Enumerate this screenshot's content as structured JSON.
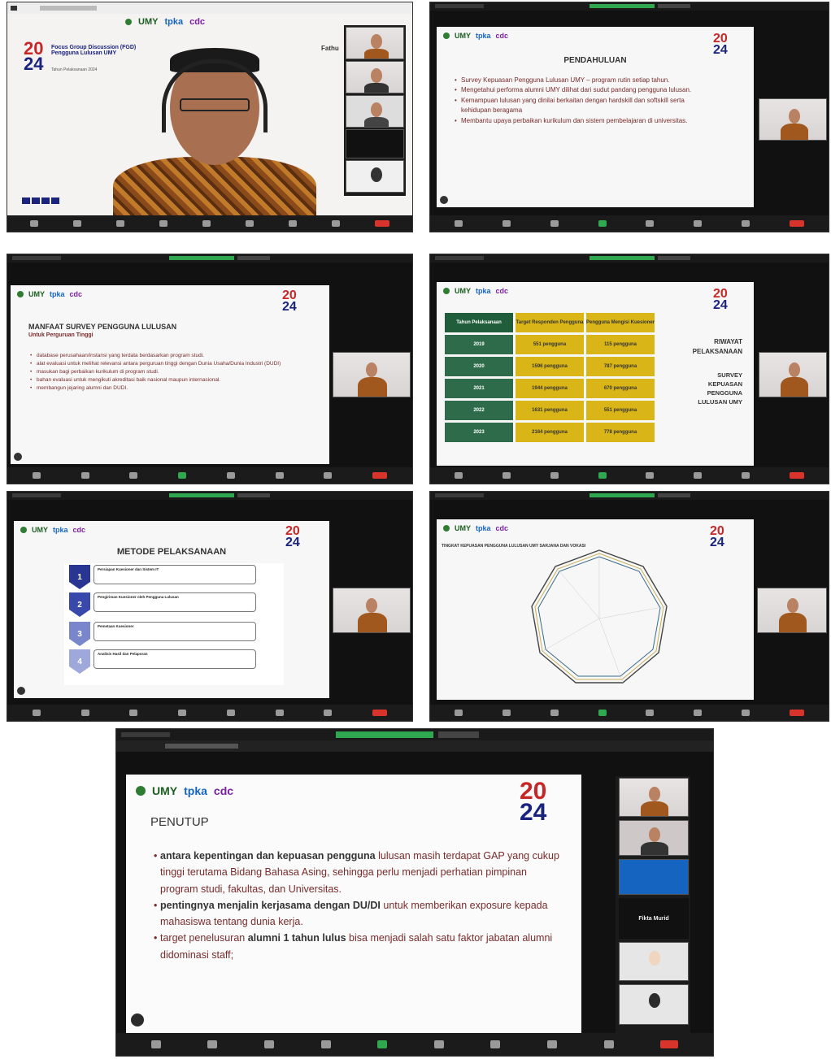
{
  "colors": {
    "accent_red": "#c62828",
    "accent_navy": "#1a237e",
    "record_green": "#2fa84f",
    "end_red": "#d9342b",
    "umy_green": "#1b5e20"
  },
  "logos": {
    "umy": "UMY",
    "tpka": "tpka",
    "cdc": "cdc"
  },
  "badge": {
    "top": "20",
    "bottom": "24"
  },
  "shot1": {
    "fgd_title": "Focus Group Discussion (FGD) Pengguna Lulusan UMY",
    "fgd_year": "Tahun Pelaksanaan 2024",
    "speaker_name": "Fathu"
  },
  "shot2": {
    "title": "PENDAHULUAN",
    "bullets": [
      {
        "text": "Survey Kepuasan Pengguna Lulusan UMY – program rutin setiap tahun."
      },
      {
        "text": "Mengetahui performa alumni UMY dilihat dari sudut pandang pengguna lulusan."
      },
      {
        "text": "Kemampuan lulusan yang dinilai berkaitan dengan hardskill dan softskill serta kehidupan beragama"
      },
      {
        "text": "Membantu upaya perbaikan kurikulum dan sistem pembelajaran di universitas."
      }
    ]
  },
  "shot3": {
    "title": "MANFAAT SURVEY PENGGUNA LULUSAN",
    "subtitle": "Untuk Perguruan Tinggi",
    "bullets": [
      {
        "text": "database perusahaan/instansi yang terdata berdasarkan program studi."
      },
      {
        "text": "alat evaluasi untuk melihat relevansi antara perguruan tinggi dengan Dunia Usaha/Dunia Industri (DUDI)"
      },
      {
        "text": "masukan bagi perbaikan kurikulum di program studi."
      },
      {
        "text": "bahan evaluasi untuk mengikuti akreditasi baik nasional maupun internasional."
      },
      {
        "text": "membangun jejaring alumni dan DUDI."
      }
    ]
  },
  "shot4": {
    "headers": [
      "Tahun Pelaksanaan",
      "Target Responden Pengguna",
      "Pengguna Mengisi Kuesioner"
    ],
    "rows": [
      [
        "2019",
        "551 pengguna",
        "115 pengguna"
      ],
      [
        "2020",
        "1596 pengguna",
        "787 pengguna"
      ],
      [
        "2021",
        "1944 pengguna",
        "670 pengguna"
      ],
      [
        "2022",
        "1631 pengguna",
        "551 pengguna"
      ],
      [
        "2023",
        "2164 pengguna",
        "778 pengguna"
      ]
    ],
    "side_title": "RIWAYAT PELAKSANAAN",
    "side_sub": "SURVEY KEPUASAN PENGGUNA LULUSAN UMY"
  },
  "shot5": {
    "title": "METODE PELAKSANAAN",
    "steps": [
      {
        "num": "1",
        "head": "Persiapan Kuesioner dan Sistem IT"
      },
      {
        "num": "2",
        "head": "Pengiriman Kuesioner oleh Pengguna Lulusan"
      },
      {
        "num": "3",
        "head": "Pemetaan Kuesioner"
      },
      {
        "num": "4",
        "head": "Analisis Hasil dan Pelaporan"
      }
    ]
  },
  "shot6": {
    "chart_title": "TINGKAT KEPUASAN PENGGUNA LULUSAN UMY SARJANA DAN VOKASI"
  },
  "shot7": {
    "title": "PENUTUP",
    "bullets": [
      {
        "bold": "antara kepentingan dan kepuasan pengguna",
        "rest": " lulusan masih terdapat GAP yang cukup tinggi terutama Bidang Bahasa Asing, sehingga perlu menjadi perhatian pimpinan program studi, fakultas, dan Universitas."
      },
      {
        "bold": "pentingnya menjalin kerjasama dengan DU/DI",
        "rest": " untuk memberikan exposure kepada mahasiswa tentang dunia kerja."
      },
      {
        "pre": "target penelusuran ",
        "bold": "alumni 1 tahun lulus",
        "rest": "  bisa menjadi salah satu faktor jabatan alumni didominasi staff;"
      }
    ],
    "participant_label": "Fikta Murid"
  }
}
